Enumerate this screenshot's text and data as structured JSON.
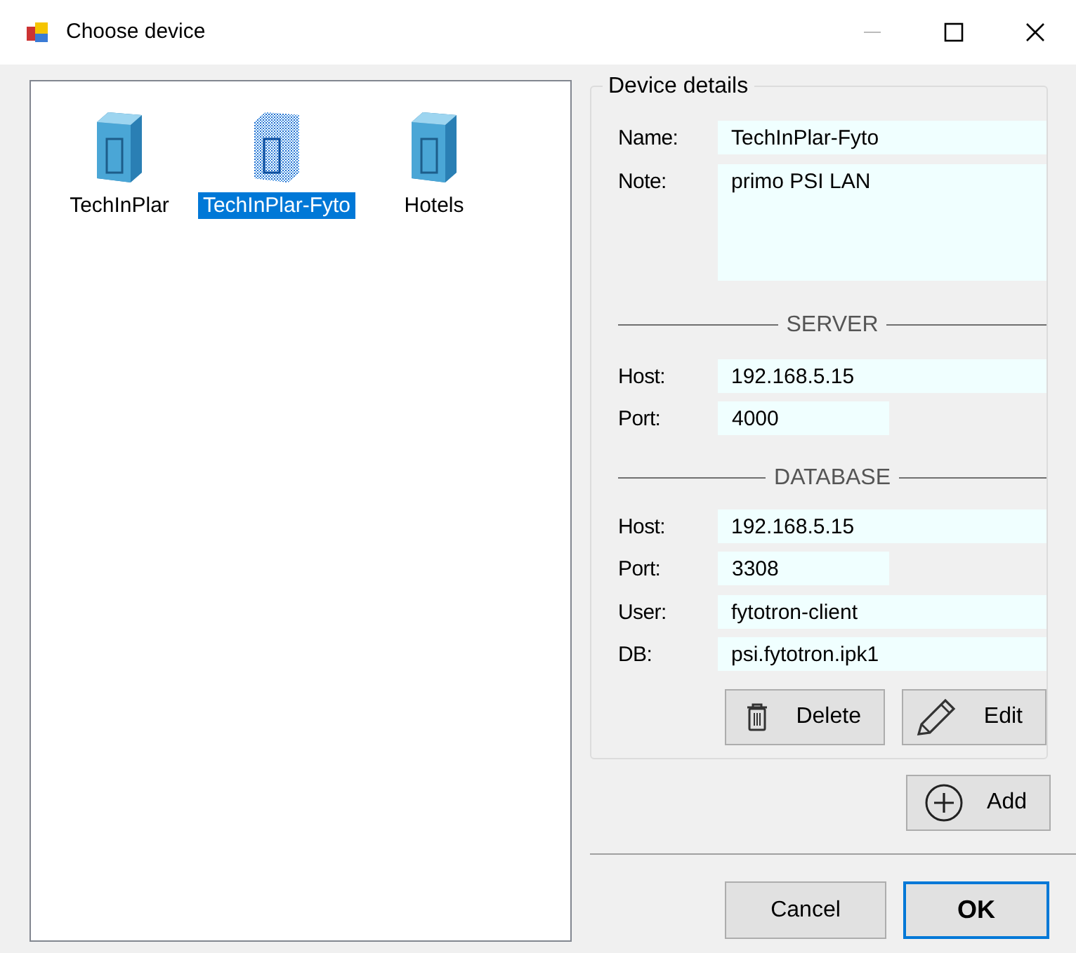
{
  "window": {
    "title": "Choose device"
  },
  "devices": [
    {
      "label": "TechInPlar",
      "selected": false
    },
    {
      "label": "TechInPlar-Fyto",
      "selected": true
    },
    {
      "label": "Hotels",
      "selected": false
    }
  ],
  "details": {
    "title": "Device details",
    "groups": [
      {
        "fields": [
          {
            "label": "Name:",
            "value": "TechInPlar-Fyto",
            "kind": "wide"
          },
          {
            "label": "Note:",
            "value": "primo PSI LAN",
            "kind": "note"
          }
        ]
      },
      {
        "heading": "SERVER",
        "fields": [
          {
            "label": "Host:",
            "value": "192.168.5.15",
            "kind": "wide"
          },
          {
            "label": "Port:",
            "value": "4000",
            "kind": "short"
          }
        ]
      },
      {
        "heading": "DATABASE",
        "fields": [
          {
            "label": "Host:",
            "value": "192.168.5.15",
            "kind": "wide"
          },
          {
            "label": "Port:",
            "value": "3308",
            "kind": "short"
          },
          {
            "label": "User:",
            "value": "fytotron-client",
            "kind": "wide"
          },
          {
            "label": "DB:",
            "value": "psi.fytotron.ipk1",
            "kind": "wide"
          }
        ]
      }
    ],
    "buttons": [
      {
        "label": "Delete"
      },
      {
        "label": "Edit"
      }
    ]
  },
  "add_button": {
    "label": "Add"
  },
  "dialog_buttons": [
    {
      "label": "Cancel",
      "default": false
    },
    {
      "label": "OK",
      "default": true
    }
  ]
}
